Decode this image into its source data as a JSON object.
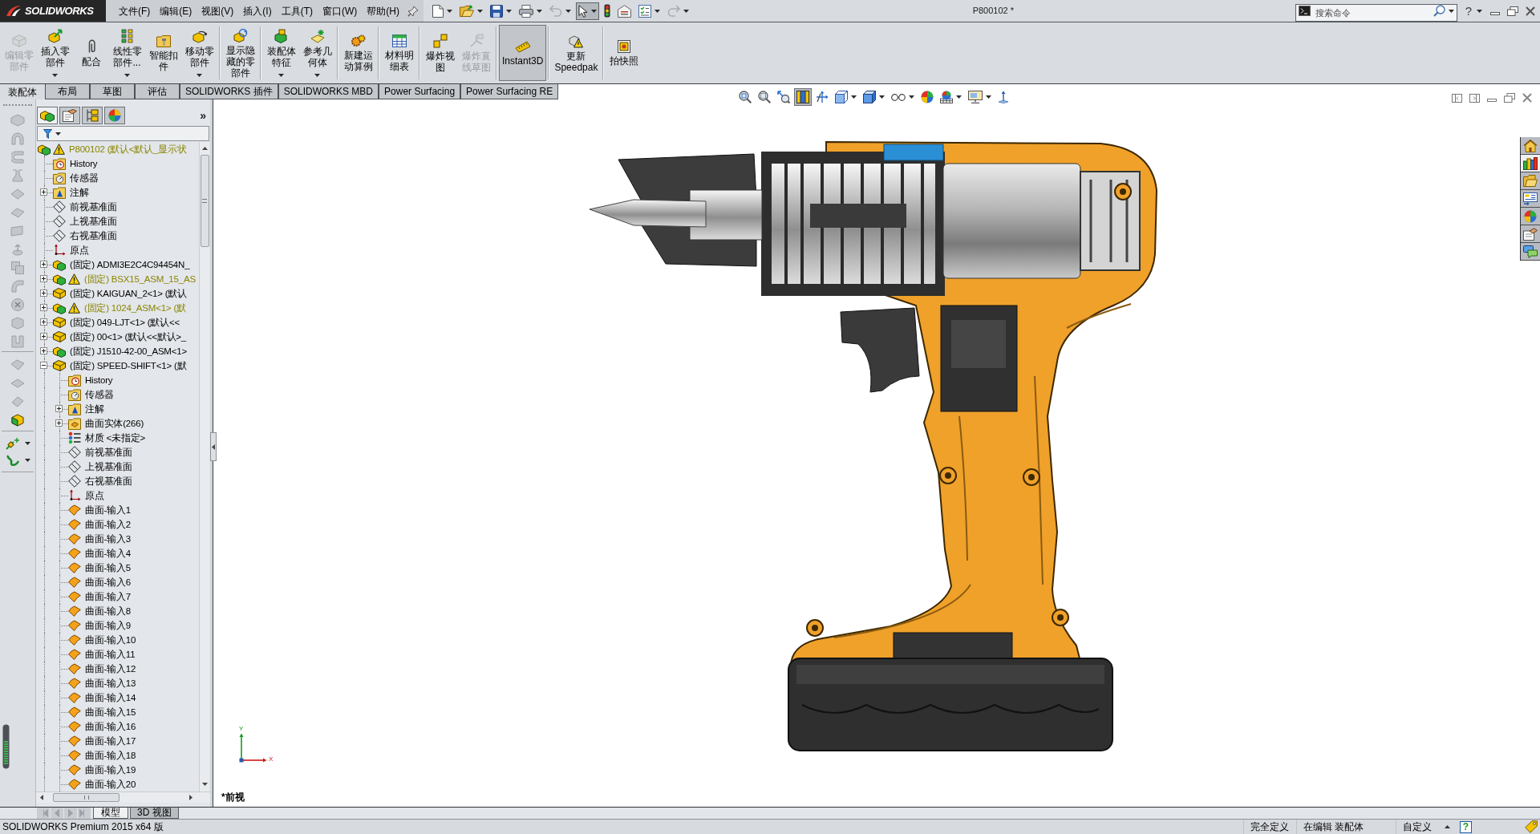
{
  "title_bar": {
    "logo": "SOLIDWORKS",
    "menus": [
      "文件(F)",
      "编辑(E)",
      "视图(V)",
      "插入(I)",
      "工具(T)",
      "窗口(W)",
      "帮助(H)"
    ],
    "quick_access": [
      {
        "dropdown": true,
        "selected": false,
        "disabled": false
      },
      {
        "dropdown": true,
        "selected": false,
        "disabled": false
      },
      {
        "dropdown": true,
        "selected": false,
        "disabled": false
      },
      {
        "dropdown": true,
        "selected": false,
        "disabled": false
      },
      {
        "dropdown": true,
        "selected": false,
        "disabled": true
      },
      {
        "dropdown": true,
        "selected": true,
        "disabled": false
      },
      {
        "dropdown": false,
        "selected": false,
        "disabled": false
      },
      {
        "dropdown": false,
        "selected": false,
        "disabled": false
      },
      {
        "dropdown": true,
        "selected": false,
        "disabled": false
      },
      {
        "dropdown": true,
        "selected": false,
        "disabled": true
      }
    ],
    "document_title": "P800102 *",
    "search": {
      "placeholder": "搜索命令"
    },
    "help": "?"
  },
  "command_manager": {
    "groups": [
      [
        {
          "label": "编辑零部件",
          "disabled": true,
          "dropdown": false,
          "selected": false
        },
        {
          "label": "插入零部件",
          "disabled": false,
          "dropdown": true,
          "selected": false
        },
        {
          "label": "配合",
          "disabled": false,
          "dropdown": false,
          "selected": false
        },
        {
          "label": "线性零部件...",
          "disabled": false,
          "dropdown": true,
          "selected": false
        },
        {
          "label": "智能扣件",
          "disabled": false,
          "dropdown": false,
          "selected": false
        },
        {
          "label": "移动零部件",
          "disabled": false,
          "dropdown": true,
          "selected": false
        }
      ],
      [
        {
          "label": "显示隐藏的零部件",
          "disabled": false,
          "dropdown": false,
          "selected": false
        }
      ],
      [
        {
          "label": "装配体特征",
          "disabled": false,
          "dropdown": true,
          "selected": false
        },
        {
          "label": "参考几何体",
          "disabled": false,
          "dropdown": true,
          "selected": false
        }
      ],
      [
        {
          "label": "新建运动算例",
          "disabled": false,
          "dropdown": false,
          "selected": false
        }
      ],
      [
        {
          "label": "材料明细表",
          "disabled": false,
          "dropdown": false,
          "selected": false
        }
      ],
      [
        {
          "label": "爆炸视图",
          "disabled": false,
          "dropdown": false,
          "selected": false
        },
        {
          "label": "爆炸直线草图",
          "disabled": true,
          "dropdown": false,
          "selected": false
        }
      ],
      [
        {
          "label": "Instant3D",
          "disabled": false,
          "dropdown": false,
          "selected": true
        }
      ],
      [
        {
          "label": "更新 Speedpak",
          "disabled": false,
          "dropdown": false,
          "selected": false
        }
      ],
      [
        {
          "label": "拍快照",
          "disabled": false,
          "dropdown": false,
          "selected": false
        }
      ]
    ]
  },
  "tabs": [
    {
      "label": "装配体",
      "selected": true
    },
    {
      "label": "布局",
      "selected": false
    },
    {
      "label": "草图",
      "selected": false
    },
    {
      "label": "评估",
      "selected": false
    },
    {
      "label": "SOLIDWORKS 插件",
      "selected": false
    },
    {
      "label": "SOLIDWORKS MBD",
      "selected": false
    },
    {
      "label": "Power Surfacing",
      "selected": false
    },
    {
      "label": "Power Surfacing RE",
      "selected": false
    }
  ],
  "feature_manager": {
    "pane_tabs": [
      {
        "selected": true
      },
      {
        "selected": false
      },
      {
        "selected": false
      },
      {
        "selected": false
      }
    ],
    "more": "»",
    "tree": {
      "kind": "assembly",
      "label": "P800102 (默认<默认_显示状",
      "warning": true,
      "children": [
        {
          "kind": "history",
          "label": "History",
          "warning": false
        },
        {
          "kind": "sensors",
          "label": "传感器",
          "warning": false
        },
        {
          "kind": "annotations",
          "label": "注解",
          "warning": false,
          "expanded": false
        },
        {
          "kind": "plane",
          "label": "前视基准面",
          "warning": false
        },
        {
          "kind": "plane",
          "label": "上视基准面",
          "warning": false
        },
        {
          "kind": "plane",
          "label": "右视基准面",
          "warning": false
        },
        {
          "kind": "origin",
          "label": "原点",
          "warning": false
        },
        {
          "kind": "assembly",
          "label": "(固定) ADMI3E2C4C94454N_",
          "warning": false,
          "expanded": false
        },
        {
          "kind": "assembly",
          "label": "(固定) BSX15_ASM_15_AS",
          "warning": true,
          "expanded": false
        },
        {
          "kind": "part",
          "label": "(固定) KAIGUAN_2<1> (默认",
          "warning": false,
          "expanded": false
        },
        {
          "kind": "assembly",
          "label": "(固定) 1024_ASM<1> (默",
          "warning": true,
          "expanded": false
        },
        {
          "kind": "part",
          "label": "(固定) 049-LJT<1> (默认<<",
          "warning": false,
          "expanded": false
        },
        {
          "kind": "part",
          "label": "(固定) 00<1> (默认<<默认>_",
          "warning": false,
          "expanded": false
        },
        {
          "kind": "assembly",
          "label": "(固定) J1510-42-00_ASM<1>",
          "warning": false,
          "expanded": false
        },
        {
          "kind": "part",
          "label": "(固定) SPEED-SHIFT<1> (默",
          "warning": false,
          "expanded": true,
          "children": [
            {
              "kind": "history",
              "label": "History"
            },
            {
              "kind": "sensors",
              "label": "传感器"
            },
            {
              "kind": "annotations",
              "label": "注解",
              "expanded": false
            },
            {
              "kind": "bodies",
              "label": "曲面实体(266)",
              "expanded": false
            },
            {
              "kind": "material",
              "label": "材质 <未指定>"
            },
            {
              "kind": "plane",
              "label": "前视基准面"
            },
            {
              "kind": "plane",
              "label": "上视基准面"
            },
            {
              "kind": "plane",
              "label": "右视基准面"
            },
            {
              "kind": "origin",
              "label": "原点"
            },
            {
              "kind": "surface",
              "label": "曲面-输入1"
            },
            {
              "kind": "surface",
              "label": "曲面-输入2"
            },
            {
              "kind": "surface",
              "label": "曲面-输入3"
            },
            {
              "kind": "surface",
              "label": "曲面-输入4"
            },
            {
              "kind": "surface",
              "label": "曲面-输入5"
            },
            {
              "kind": "surface",
              "label": "曲面-输入6"
            },
            {
              "kind": "surface",
              "label": "曲面-输入7"
            },
            {
              "kind": "surface",
              "label": "曲面-输入8"
            },
            {
              "kind": "surface",
              "label": "曲面-输入9"
            },
            {
              "kind": "surface",
              "label": "曲面-输入10"
            },
            {
              "kind": "surface",
              "label": "曲面-输入11"
            },
            {
              "kind": "surface",
              "label": "曲面-输入12"
            },
            {
              "kind": "surface",
              "label": "曲面-输入13"
            },
            {
              "kind": "surface",
              "label": "曲面-输入14"
            },
            {
              "kind": "surface",
              "label": "曲面-输入15"
            },
            {
              "kind": "surface",
              "label": "曲面-输入16"
            },
            {
              "kind": "surface",
              "label": "曲面-输入17"
            },
            {
              "kind": "surface",
              "label": "曲面-输入18"
            },
            {
              "kind": "surface",
              "label": "曲面-输入19"
            },
            {
              "kind": "surface",
              "label": "曲面-输入20"
            }
          ]
        }
      ]
    }
  },
  "graphics": {
    "view_toolbar": [
      {
        "selected": false,
        "dropdown": false
      },
      {
        "selected": false,
        "dropdown": false
      },
      {
        "selected": false,
        "dropdown": false
      },
      {
        "selected": true,
        "dropdown": false
      },
      {
        "selected": false,
        "dropdown": false
      },
      {
        "selected": false,
        "dropdown": true
      },
      {
        "selected": false,
        "dropdown": true
      },
      {
        "selected": false,
        "dropdown": true
      },
      {
        "selected": false,
        "dropdown": false
      },
      {
        "selected": false,
        "dropdown": true
      },
      {
        "selected": false,
        "dropdown": true
      },
      {
        "selected": false,
        "dropdown": false
      }
    ],
    "task_pane": [
      {
        "selected": false
      },
      {
        "selected": true
      },
      {
        "selected": false
      },
      {
        "selected": false
      },
      {
        "selected": false
      },
      {
        "selected": false
      },
      {
        "selected": false
      }
    ],
    "triad": {
      "y_label": "Y",
      "x_label": "X"
    },
    "view_name": "*前视"
  },
  "bottom_tabs": [
    {
      "label": "模型",
      "selected": true
    },
    {
      "label": "3D 视图",
      "selected": false
    }
  ],
  "status_bar": {
    "product": "SOLIDWORKS Premium 2015 x64 版",
    "fields": [
      "完全定义",
      "在编辑 装配体",
      "自定义"
    ],
    "help": "?"
  }
}
